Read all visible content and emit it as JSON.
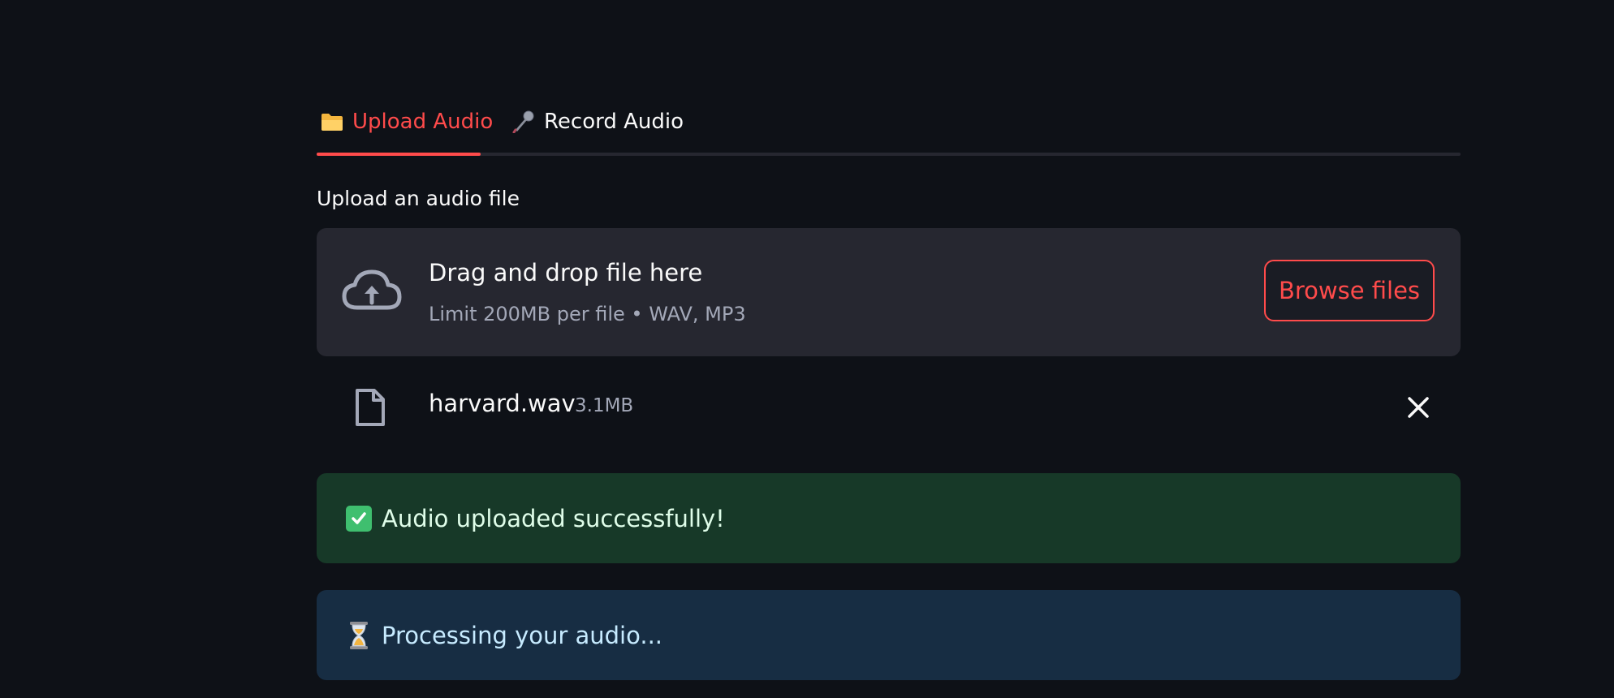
{
  "tabs": [
    {
      "label": "Upload Audio",
      "icon": "folder-icon",
      "active": true
    },
    {
      "label": "Record Audio",
      "icon": "microphone-icon",
      "active": false
    }
  ],
  "uploader": {
    "label": "Upload an audio file",
    "drop_title": "Drag and drop file here",
    "drop_subtitle": "Limit 200MB per file • WAV, MP3",
    "browse_label": "Browse files"
  },
  "file": {
    "name": "harvard.wav",
    "size": "3.1MB"
  },
  "alerts": {
    "success": "Audio uploaded successfully!",
    "info": "Processing your audio..."
  },
  "colors": {
    "background": "#0e1117",
    "accent": "#ff4b4b",
    "success_bg": "#173928",
    "info_bg": "#172d43"
  }
}
